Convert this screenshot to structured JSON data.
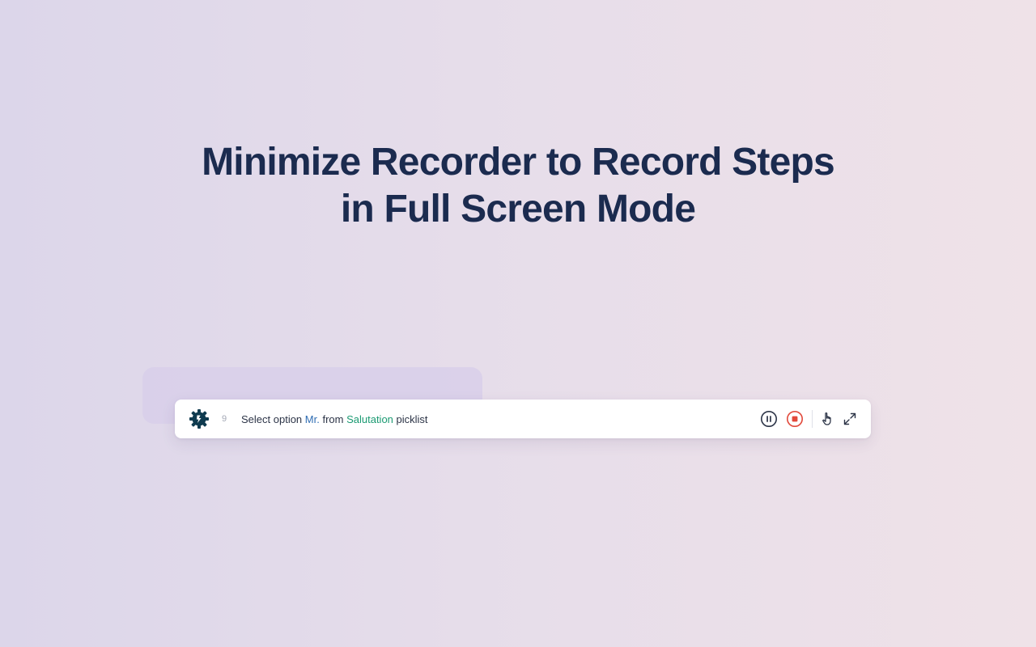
{
  "headline": {
    "line1": "Minimize Recorder to Record Steps",
    "line2": "in Full Screen Mode"
  },
  "recorder": {
    "step_number": "9",
    "step": {
      "prefix": "Select option ",
      "value": "Mr.",
      "middle": " from ",
      "field": "Salutation",
      "suffix": " picklist"
    },
    "colors": {
      "value": "#2f6db3",
      "field": "#1b9a72",
      "stop": "#e2493b",
      "icon": "#2c3447"
    },
    "icons": {
      "logo": "gear-logo-icon",
      "pause": "pause-icon",
      "stop": "stop-icon",
      "pointer": "hand-pointer-icon",
      "expand": "expand-icon"
    }
  }
}
